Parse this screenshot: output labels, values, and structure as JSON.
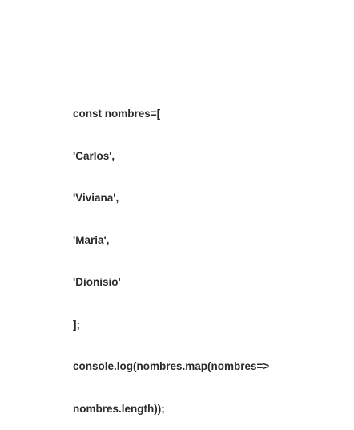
{
  "code": {
    "lines": [
      "const nombres=[",
      "'Carlos',",
      "'Viviana',",
      "'Maria',",
      "'Dionisio'",
      "];",
      "console.log(nombres.map(nombres=>",
      "nombres.length));"
    ]
  }
}
